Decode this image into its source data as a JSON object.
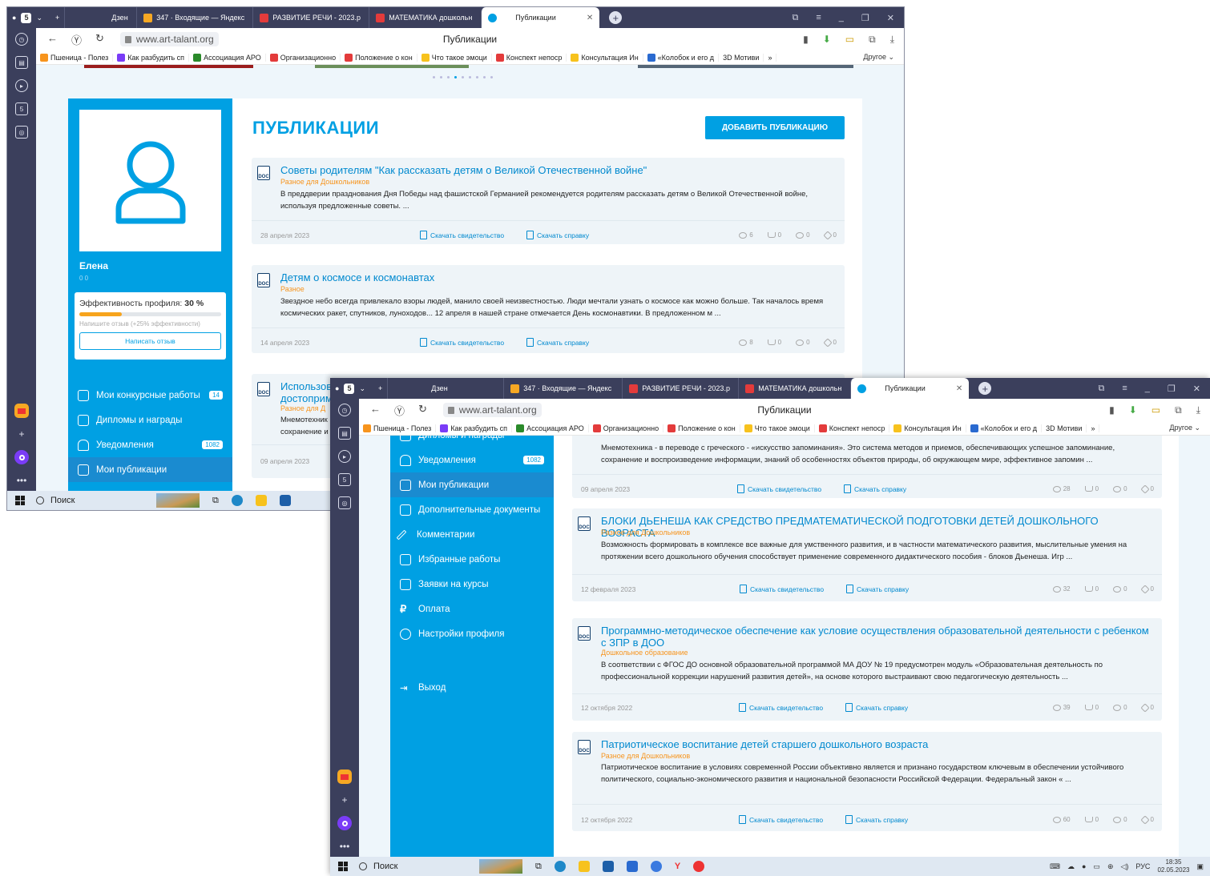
{
  "browser": {
    "profile_count": "5",
    "tabs": [
      {
        "label": "Дзен",
        "color": "#3b3f5c"
      },
      {
        "label": "347 · Входящие — Яндекс",
        "color": "#f7a823"
      },
      {
        "label": "РАЗВИТИЕ РЕЧИ - 2023.р",
        "color": "#e33b3b"
      },
      {
        "label": "МАТЕМАТИКА дошкольн",
        "color": "#e33b3b"
      },
      {
        "label": "Публикации",
        "color": "#00a0e3"
      }
    ],
    "address": "www.art-talant.org",
    "page_title": "Публикации",
    "bookmarks": [
      {
        "label": "Пшеница - Полез",
        "color": "#f7941d"
      },
      {
        "label": "Как разбудить сп",
        "color": "#7a3cf7"
      },
      {
        "label": "Ассоциация АРО",
        "color": "#2a8a2a"
      },
      {
        "label": "Организационно",
        "color": "#e33b3b"
      },
      {
        "label": "Положение о кон",
        "color": "#e33b3b"
      },
      {
        "label": "Что такое эмоци",
        "color": "#f7c21d"
      },
      {
        "label": "Конспект непоср",
        "color": "#e33b3b"
      },
      {
        "label": "Консультация Ин",
        "color": "#f7c21d"
      },
      {
        "label": "«Колобок и его д",
        "color": "#2a6ad0"
      },
      {
        "label": "3D Мотиви",
        "color": "#333333"
      }
    ],
    "bookmarks_more": "»",
    "bookmarks_other": "Другое ⌄"
  },
  "taskbar": {
    "search": "Поиск",
    "lang": "РУС",
    "time": "18:35",
    "date": "02.05.2023"
  },
  "profile": {
    "name": "Елена",
    "sub": "0 0",
    "efficiency_label": "Эффективность профиля:",
    "efficiency_value": "30 %",
    "efficiency_fraction": 0.3,
    "hint": "Напишите отзыв (+25% эффективности)",
    "review_button": "Написать отзыв"
  },
  "menu": [
    {
      "label": "Мои конкурсные работы",
      "badge": "14"
    },
    {
      "label": "Дипломы и награды",
      "badge": ""
    },
    {
      "label": "Уведомления",
      "badge": "1082"
    },
    {
      "label": "Мои публикации",
      "badge": ""
    },
    {
      "label": "Дополнительные документы",
      "badge": ""
    },
    {
      "label": "Комментарии",
      "badge": ""
    },
    {
      "label": "Избранные работы",
      "badge": ""
    },
    {
      "label": "Заявки на курсы",
      "badge": ""
    },
    {
      "label": "Оплата",
      "badge": ""
    },
    {
      "label": "Настройки профиля",
      "badge": ""
    },
    {
      "label": "Выход",
      "badge": ""
    }
  ],
  "main": {
    "title": "ПУБЛИКАЦИИ",
    "add_button": "ДОБАВИТЬ ПУБЛИКАЦИЮ",
    "download_cert": "Скачать свидетельство",
    "download_ref": "Скачать справку",
    "doc_badge": "DOC"
  },
  "publications": [
    {
      "title": "Советы родителям \"Как рассказать детям о Великой Отечественной войне\"",
      "category": "Разное для Дошкольников",
      "desc": "В преддверии празднования Дня Победы над фашистской Германией рекомендуется родителям рассказать детям о Великой Отечественной войне, используя предложенные советы. ...",
      "date": "28 апреля 2023",
      "views": "6",
      "downloads": "0",
      "comments": "0",
      "stars": "0"
    },
    {
      "title": "Детям о космосе и космонавтах",
      "category": "Разное",
      "desc": "Звездное небо всегда привлекало взоры людей, манило своей неизвестностью. Люди мечтали узнать о космосе как можно больше. Так началось время космических ракет, спутников, луноходов... 12 апреля в нашей стране отмечается День космонавтики. В предложенном м ...",
      "date": "14 апреля 2023",
      "views": "8",
      "downloads": "0",
      "comments": "0",
      "stars": "0"
    },
    {
      "title": "Использование мнемотехники для ознакомления детей с достопримечательностями",
      "title_short": "Использов",
      "title_short2": "достоприм",
      "category": "Разное для Дошкольников",
      "category_short": "Разное для Д",
      "desc": "Мнемотехника - в переводе с греческого - «искусство запоминания». Это система методов и приемов, обеспечивающих успешное запоминание, сохранение и воспроизведение информации, знаний об особенностях объектов природы, об окружающем мире, эффективное запомин ...",
      "desc_short1": "Мнемотехник",
      "desc_short2": "сохранение и",
      "date": "09 апреля 2023",
      "views": "28",
      "downloads": "0",
      "comments": "0",
      "stars": "0"
    },
    {
      "title": "БЛОКИ ДЬЕНЕША КАК СРЕДСТВО ПРЕДМАТЕМАТИЧЕСКОЙ ПОДГОТОВКИ ДЕТЕЙ ДОШКОЛЬНОГО ВОЗРАСТА",
      "category": "Разное для Дошкольников",
      "desc": "Возможность формировать в комплексе все важные для умственного развития, и в частности математического развития, мыслительные умения на протяжении всего дошкольного обучения способствует применение современного дидактического пособия - блоков Дьенеша. Игр ...",
      "date": "12 февраля 2023",
      "views": "32",
      "downloads": "0",
      "comments": "0",
      "stars": "0"
    },
    {
      "title": "Программно-методическое обеспечение как условие осуществления образовательной деятельности с ребенком с ЗПР в ДОО",
      "category": "Дошкольное образование",
      "desc": "В соответствии с ФГОС ДО основной образовательной программой МА ДОУ № 19 предусмотрен модуль «Образовательная деятельность по профессиональной коррекции нарушений развития детей», на основе которого выстраивают свою педагогическую деятельность ...",
      "date": "12 октября 2022",
      "views": "39",
      "downloads": "0",
      "comments": "0",
      "stars": "0"
    },
    {
      "title": "Патриотическое воспитание детей старшего дошкольного возраста",
      "category": "Разное для Дошкольников",
      "desc": "Патриотическое воспитание в условиях современной России объективно является и признано государством ключевым в обеспечении устойчивого политического, социально-экономического развития и национальной безопасности Российской Федерации. Федеральный закон « ...",
      "date": "12 октября 2022",
      "views": "60",
      "downloads": "0",
      "comments": "0",
      "stars": "0"
    }
  ]
}
